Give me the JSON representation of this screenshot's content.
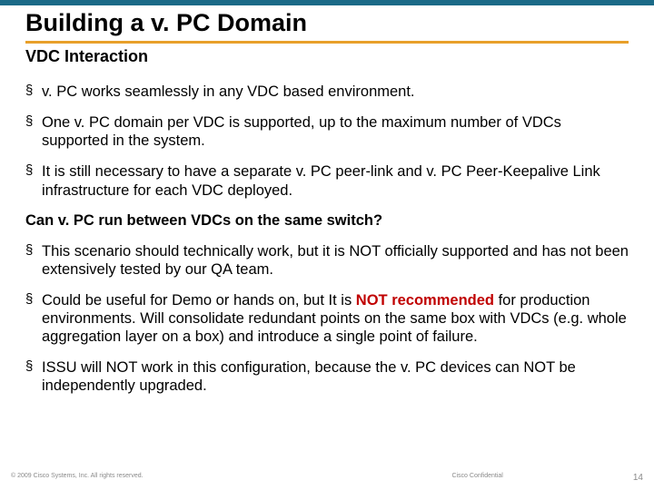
{
  "title": "Building a v. PC Domain",
  "subtitle": "VDC Interaction",
  "bullets1": [
    "v. PC works seamlessly in any VDC based environment.",
    "One v. PC domain per VDC is supported, up to the maximum number of VDCs supported in the system.",
    "It is still necessary to have a separate v. PC peer-link and v. PC Peer-Keepalive Link infrastructure for each VDC deployed."
  ],
  "question": "Can v. PC run between VDCs on the same switch?",
  "bullets2_0": "This scenario should technically work, but it is NOT officially supported and has not been extensively tested by our QA team.",
  "bullets2_1_pre": "Could be useful for Demo or hands on, but It is ",
  "bullets2_1_not": "NOT recommended",
  "bullets2_1_post": " for production environments. Will consolidate redundant points on the same box with VDCs (e.g. whole aggregation layer on a box) and introduce a single point of failure.",
  "bullets2_2": "ISSU will NOT work in this configuration, because the v. PC devices can NOT be independently upgraded.",
  "footer": {
    "left": "© 2009 Cisco Systems, Inc. All rights reserved.",
    "center": "Cisco Confidential",
    "right": "14"
  }
}
